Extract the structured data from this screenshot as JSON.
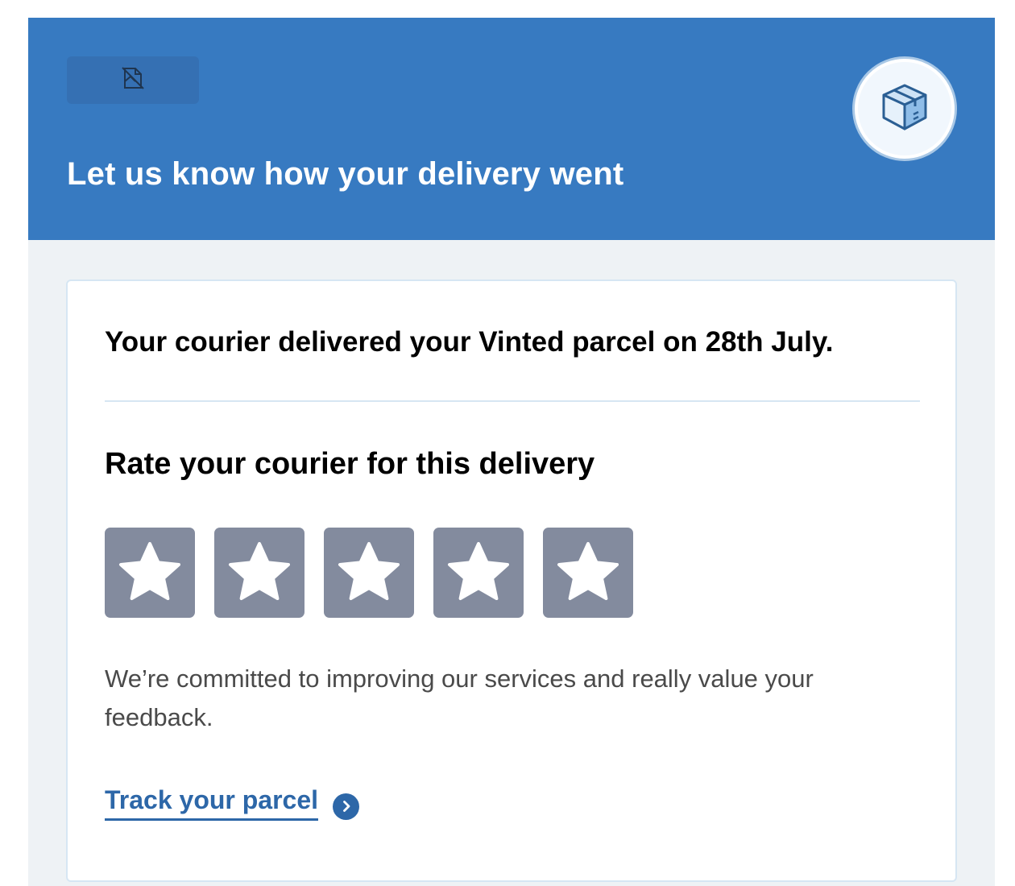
{
  "header": {
    "logo_icon": "broken-image-icon",
    "title": "Let us know how your delivery went",
    "badge_icon": "parcel-box-icon"
  },
  "card": {
    "delivered_message": "Your courier delivered your Vinted parcel on 28th July.",
    "rating_heading": "Rate your courier for this delivery",
    "rating": {
      "max_stars": 5,
      "selected": 0,
      "star_icon": "star-icon"
    },
    "feedback_message": "We’re committed to improving our services and really value your feedback.",
    "track_link_label": "Track your parcel",
    "track_link_icon": "chevron-right-icon"
  },
  "colors": {
    "brand_blue": "#377ac1",
    "link_blue": "#2d67a8",
    "star_grey": "#838b9e",
    "page_bg": "#eef2f5"
  }
}
